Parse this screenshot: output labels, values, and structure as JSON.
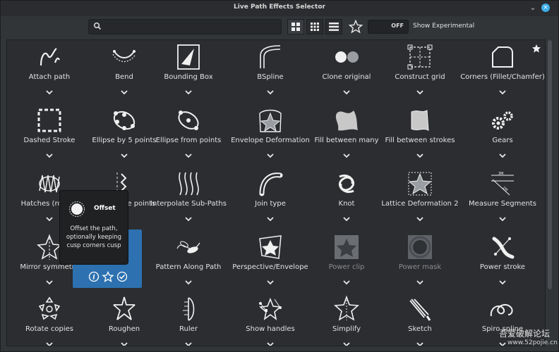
{
  "window": {
    "title": "Live Path Effects Selector"
  },
  "toolbar": {
    "search_placeholder": "",
    "toggle_label": "OFF",
    "experimental_label": "Show Experimental"
  },
  "effects": [
    {
      "name": "Attach path",
      "icon": "attach-path-icon"
    },
    {
      "name": "Bend",
      "icon": "bend-icon"
    },
    {
      "name": "Bounding Box",
      "icon": "bounding-box-icon"
    },
    {
      "name": "BSpline",
      "icon": "bspline-icon"
    },
    {
      "name": "Clone original",
      "icon": "clone-original-icon"
    },
    {
      "name": "Construct grid",
      "icon": "construct-grid-icon"
    },
    {
      "name": "Corners (Fillet/Chamfer)",
      "icon": "corners-icon"
    },
    {
      "name": "Dashed Stroke",
      "icon": "dashed-stroke-icon"
    },
    {
      "name": "Ellipse by 5 points",
      "icon": "ellipse-5-points-icon"
    },
    {
      "name": "Ellipse from points",
      "icon": "ellipse-from-points-icon"
    },
    {
      "name": "Envelope Deformation",
      "icon": "envelope-deformation-icon"
    },
    {
      "name": "Fill between many",
      "icon": "fill-between-many-icon"
    },
    {
      "name": "Fill between strokes",
      "icon": "fill-between-strokes-icon"
    },
    {
      "name": "Gears",
      "icon": "gears-icon"
    },
    {
      "name": "Hatches (rough)",
      "icon": "hatches-icon"
    },
    {
      "name": "Interpolate points",
      "icon": "interpolate-points-icon"
    },
    {
      "name": "Interpolate Sub-Paths",
      "icon": "interpolate-subpaths-icon"
    },
    {
      "name": "Join type",
      "icon": "join-type-icon"
    },
    {
      "name": "Knot",
      "icon": "knot-icon"
    },
    {
      "name": "Lattice Deformation 2",
      "icon": "lattice-deformation-icon"
    },
    {
      "name": "Measure Segments",
      "icon": "measure-segments-icon"
    },
    {
      "name": "Mirror symmetry",
      "icon": "mirror-symmetry-icon"
    },
    {
      "name": "Offset",
      "icon": "offset-icon"
    },
    {
      "name": "Pattern Along Path",
      "icon": "pattern-along-path-icon"
    },
    {
      "name": "Perspective/Envelope",
      "icon": "perspective-envelope-icon"
    },
    {
      "name": "Power clip",
      "icon": "power-clip-icon"
    },
    {
      "name": "Power mask",
      "icon": "power-mask-icon"
    },
    {
      "name": "Power stroke",
      "icon": "power-stroke-icon"
    },
    {
      "name": "Rotate copies",
      "icon": "rotate-copies-icon"
    },
    {
      "name": "Roughen",
      "icon": "roughen-icon"
    },
    {
      "name": "Ruler",
      "icon": "ruler-icon"
    },
    {
      "name": "Show handles",
      "icon": "show-handles-icon"
    },
    {
      "name": "Simplify",
      "icon": "simplify-icon"
    },
    {
      "name": "Sketch",
      "icon": "sketch-icon"
    },
    {
      "name": "Spiro spline",
      "icon": "spiro-spline-icon"
    }
  ],
  "selected": {
    "name": "Offset"
  },
  "tooltip": {
    "title": "Offset",
    "description": "Offset the path, optionally keeping cusp corners cusp"
  },
  "watermark": {
    "line1": "吾爱破解论坛",
    "line2": "www.52pojie.cn"
  },
  "colors": {
    "selection": "#2d71b0",
    "accent_close": "#3daee9",
    "background": "#2b2d30"
  }
}
